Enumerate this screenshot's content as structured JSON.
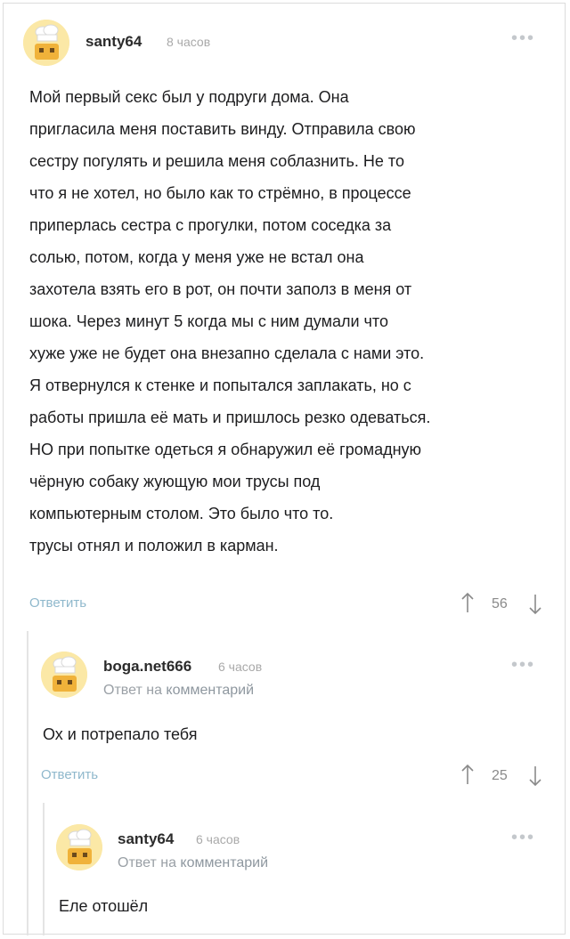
{
  "comment1": {
    "username": "santy64",
    "time": "8 часов",
    "lines": [
      "Мой первый секс был у подруги дома. Она",
      "пригласила меня поставить винду. Отправила свою",
      "сестру погулять и решила меня соблазнить. Не то",
      "что я не хотел, но было как то стрёмно, в процессе",
      "приперлась сестра с прогулки, потом соседка за",
      "солью, потом, когда у меня уже не встал она",
      "захотела взять его в рот, он почти заполз в меня от",
      "шока. Через минут 5 когда мы с ним думали что",
      "хуже уже не будет она внезапно сделала с нами это.",
      "Я отвернулся к стенке и попытался заплакать, но с",
      "работы пришла её мать и пришлось резко одеваться.",
      "НО при попытке одеться я обнаружил её громадную",
      "чёрную собаку жующую мои трусы под",
      "компьютерным столом. Это было что то.",
      "трусы отнял и положил в карман."
    ],
    "reply_label": "Ответить",
    "rating": "56"
  },
  "comment2": {
    "username": "boga.net666",
    "time": "6 часов",
    "reply_to_prefix": "Ответ на",
    "reply_to_link": "комментарий",
    "text": "Ох и потрепало тебя",
    "reply_label": "Ответить",
    "rating": "25"
  },
  "comment3": {
    "username": "santy64",
    "time": "6 часов",
    "reply_to_prefix": "Ответ на",
    "reply_to_link": "комментарий",
    "text": "Еле отошёл"
  },
  "colors": {
    "avatar_bg": "#fbe8a6",
    "reply_link": "#8fb8cc",
    "muted": "#a9a9a9"
  },
  "icons": [
    "chef-avatar",
    "more-dots-icon",
    "arrow-up-icon",
    "arrow-down-icon"
  ]
}
